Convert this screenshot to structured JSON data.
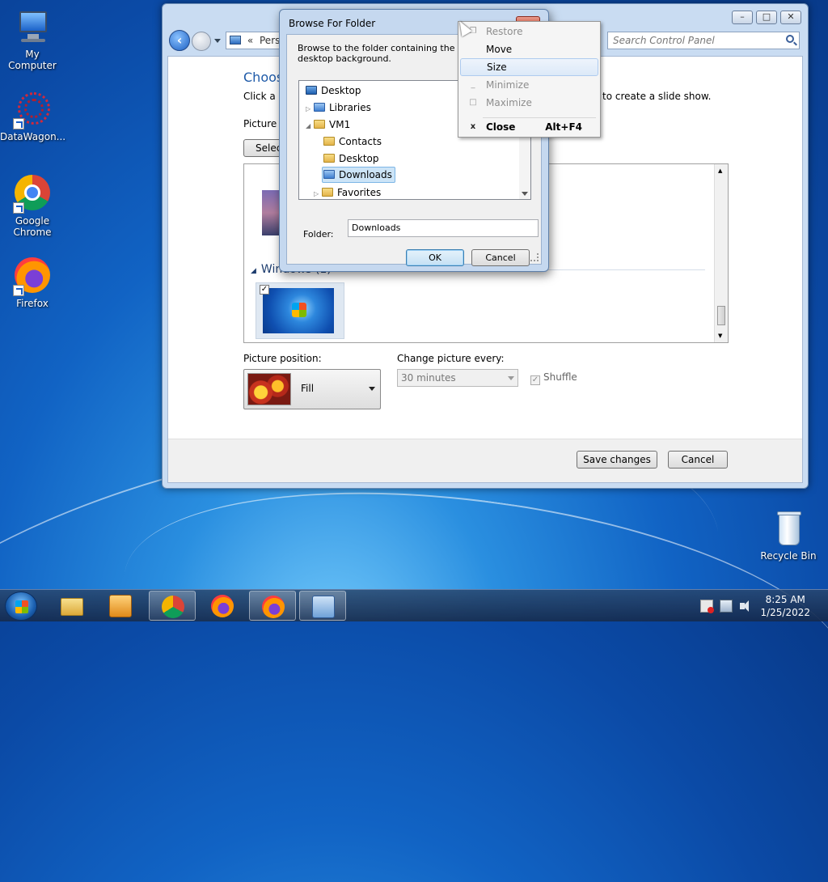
{
  "desktop": {
    "icons": [
      {
        "label": "My Computer"
      },
      {
        "label": "DataWagon..."
      },
      {
        "label": "Google Chrome"
      },
      {
        "label": "Firefox"
      },
      {
        "label": "Recycle Bin"
      }
    ]
  },
  "control_panel": {
    "address": "Perso",
    "search_placeholder": "Search Control Panel",
    "heading": "Choos",
    "description": "Click a p",
    "description_tail": "to create a slide show.",
    "picture_location_label": "Picture lo",
    "select_all_label": "Select",
    "group_header": "Windows (1)",
    "picture_position_label": "Picture position:",
    "picture_position_value": "Fill",
    "change_every_label": "Change picture every:",
    "change_every_value": "30 minutes",
    "shuffle_label": "Shuffle",
    "save_label": "Save changes",
    "cancel_label": "Cancel",
    "window_buttons": {
      "minimize": "–",
      "maximize": "□",
      "close": "✕"
    }
  },
  "browse_dialog": {
    "title": "Browse For Folder",
    "description": "Browse to the folder containing the pictur use for your desktop background.",
    "tree": [
      {
        "label": "Desktop"
      },
      {
        "label": "Libraries"
      },
      {
        "label": "VM1"
      },
      {
        "label": "Contacts"
      },
      {
        "label": "Desktop"
      },
      {
        "label": "Downloads"
      },
      {
        "label": "Favorites"
      }
    ],
    "folder_label": "Folder:",
    "folder_value": "Downloads",
    "ok_label": "OK",
    "cancel_label": "Cancel"
  },
  "context_menu": {
    "items": [
      {
        "label": "Restore"
      },
      {
        "label": "Move"
      },
      {
        "label": "Size"
      },
      {
        "label": "Minimize"
      },
      {
        "label": "Maximize"
      },
      {
        "label": "Close",
        "shortcut": "Alt+F4"
      }
    ]
  },
  "taskbar": {
    "time": "8:25 AM",
    "date": "1/25/2022"
  }
}
